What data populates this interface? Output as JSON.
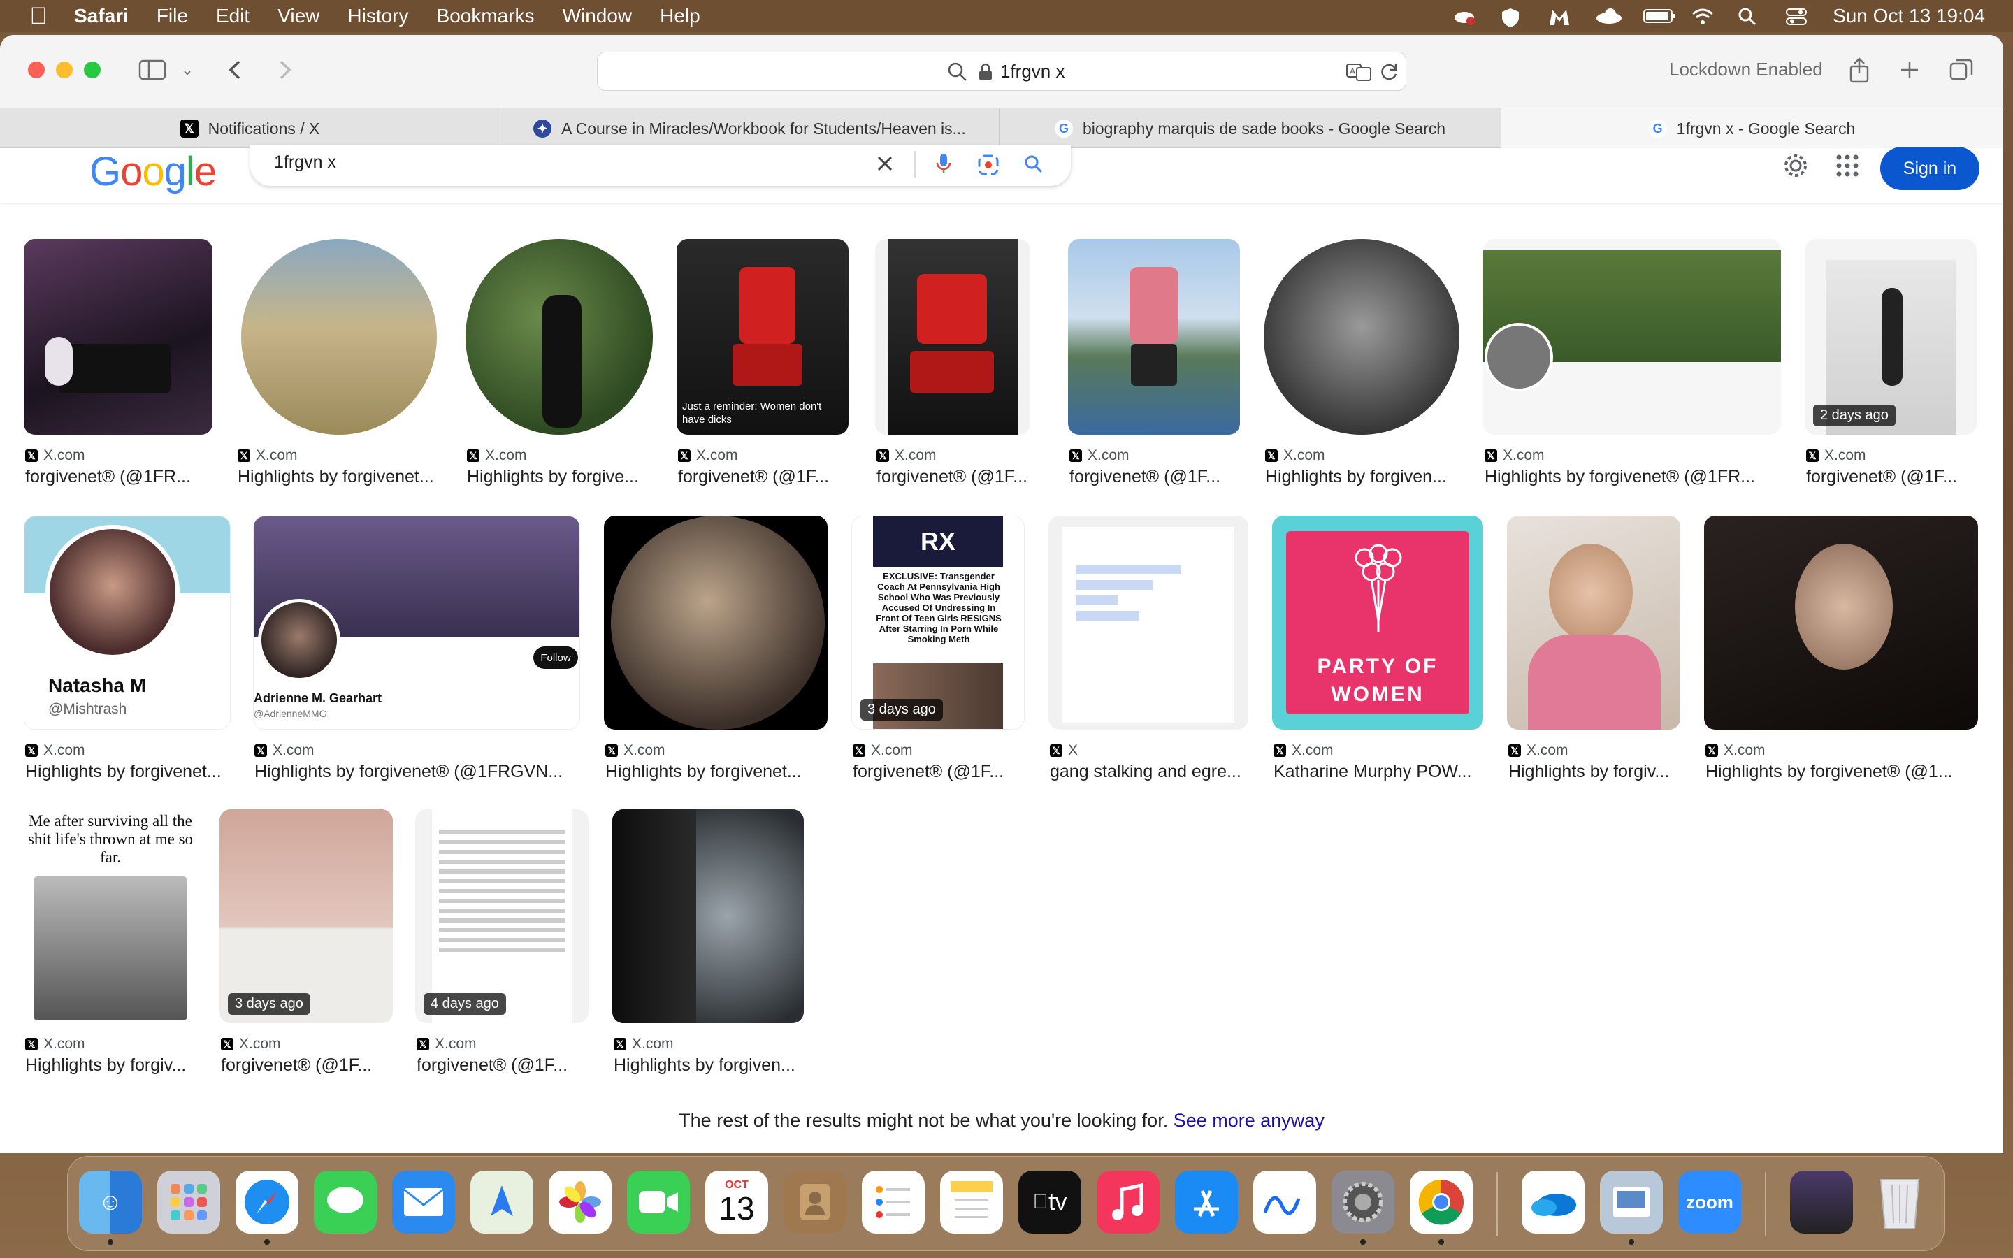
{
  "menubar": {
    "app": "Safari",
    "items": [
      "File",
      "Edit",
      "View",
      "History",
      "Bookmarks",
      "Window",
      "Help"
    ],
    "clock": "Sun Oct 13  19:04"
  },
  "toolbar": {
    "address": "1frgvn x",
    "lockdown": "Lockdown Enabled"
  },
  "tabs": [
    {
      "label": "Notifications / X",
      "favicon": "x-icon"
    },
    {
      "label": "A Course in Miracles/Workbook for Students/Heaven is...",
      "favicon": "acim-icon"
    },
    {
      "label": "biography marquis de sade books - Google Search",
      "favicon": "google-icon"
    },
    {
      "label": "1frgvn x - Google Search",
      "favicon": "google-icon",
      "active": true
    }
  ],
  "google": {
    "logo": "Google",
    "query": "1frgvn x",
    "signin": "Sign in"
  },
  "results": {
    "row1": [
      {
        "source": "X.com",
        "title": "forgivenet® (@1FR..."
      },
      {
        "source": "X.com",
        "title": "Highlights by forgivenet..."
      },
      {
        "source": "X.com",
        "title": "Highlights by forgive..."
      },
      {
        "source": "X.com",
        "title": "forgivenet® (@1F...",
        "overlay": "Just a reminder: Women don't have dicks"
      },
      {
        "source": "X.com",
        "title": "forgivenet® (@1F..."
      },
      {
        "source": "X.com",
        "title": "forgivenet® (@1F..."
      },
      {
        "source": "X.com",
        "title": "Highlights by forgiven..."
      },
      {
        "source": "X.com",
        "title": "Highlights by forgivenet® (@1FR..."
      },
      {
        "source": "X.com",
        "title": "forgivenet® (@1F...",
        "badge": "2 days ago"
      }
    ],
    "row2": [
      {
        "source": "X.com",
        "title": "Highlights by forgivenet...",
        "name": "Natasha M",
        "handle": "@Mishtrash"
      },
      {
        "source": "X.com",
        "title": "Highlights by forgivenet® (@1FRGVN...",
        "name": "Adrienne M. Gearhart",
        "handle": "@AdrienneMMG",
        "follow": "Follow"
      },
      {
        "source": "X.com",
        "title": "Highlights by forgivenet..."
      },
      {
        "source": "X.com",
        "title": "forgivenet® (@1F...",
        "badge": "3 days ago",
        "headline": "EXCLUSIVE: Transgender Coach At Pennsylvania High School Who Was Previously Accused Of Undressing In Front Of Teen Girls RESIGNS After Starring In Porn While Smoking Meth"
      },
      {
        "source": "X",
        "title": "gang stalking and egre..."
      },
      {
        "source": "X.com",
        "title": "Katharine Murphy POW...",
        "poster": "PARTY OF WOMEN"
      },
      {
        "source": "X.com",
        "title": "Highlights by forgiv..."
      },
      {
        "source": "X.com",
        "title": "Highlights by forgivenet® (@1..."
      }
    ],
    "row3": [
      {
        "source": "X.com",
        "title": "Highlights by forgiv...",
        "caption": "Me after surviving all the shit life's thrown at me so far."
      },
      {
        "source": "X.com",
        "title": "forgivenet® (@1F...",
        "badge": "3 days ago"
      },
      {
        "source": "X.com",
        "title": "forgivenet® (@1F...",
        "badge": "4 days ago"
      },
      {
        "source": "X.com",
        "title": "Highlights by forgiven..."
      }
    ],
    "footer_text": "The rest of the results might not be what you're looking for.",
    "footer_link": "See more anyway"
  },
  "dock": {
    "calendar_month": "OCT",
    "calendar_day": "13",
    "zoom_label": "zoom",
    "tv_label": "tv"
  },
  "colors": {
    "google_blue": "#4285F4",
    "google_red": "#EA4335",
    "google_yellow": "#FBBC05",
    "google_green": "#34A853",
    "signin_bg": "#0b57d0",
    "link": "#1a0dab",
    "party_pink": "#e8336b",
    "party_teal": "#5ad1d6"
  }
}
